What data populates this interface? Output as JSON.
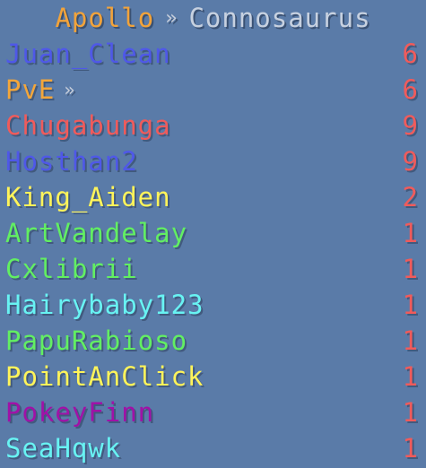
{
  "colors": {
    "background": "#5a7ba8",
    "server_brand": "#f2a33a",
    "header_separator": "#c8cfdc",
    "server_name": "#c7d1e0",
    "score": "#f05b5b"
  },
  "header": {
    "brand": "Apollo",
    "separator": "»",
    "server": "Connosaurus"
  },
  "rows": [
    {
      "name": "Juan_Clean",
      "score": "6",
      "color": "#4f58e8",
      "suffix": ""
    },
    {
      "name": "PvE",
      "score": "6",
      "color": "#f3a63a",
      "suffix": "»"
    },
    {
      "name": "Chugabunga",
      "score": "9",
      "color": "#f05b5b",
      "suffix": ""
    },
    {
      "name": "Hosthan2",
      "score": "9",
      "color": "#4f58e8",
      "suffix": ""
    },
    {
      "name": "King_Aiden",
      "score": "2",
      "color": "#fff45a",
      "suffix": ""
    },
    {
      "name": "ArtVandelay",
      "score": "1",
      "color": "#62ef62",
      "suffix": ""
    },
    {
      "name": "Cxlibrii",
      "score": "1",
      "color": "#62ef62",
      "suffix": ""
    },
    {
      "name": "Hairybaby123",
      "score": "1",
      "color": "#68f3f3",
      "suffix": ""
    },
    {
      "name": "PapuRabioso",
      "score": "1",
      "color": "#62ef62",
      "suffix": ""
    },
    {
      "name": "PointAnClick",
      "score": "1",
      "color": "#fff45a",
      "suffix": ""
    },
    {
      "name": "PokeyFinn",
      "score": "1",
      "color": "#a012a7",
      "suffix": ""
    },
    {
      "name": "SeaHqwk",
      "score": "1",
      "color": "#68f3f3",
      "suffix": ""
    }
  ]
}
